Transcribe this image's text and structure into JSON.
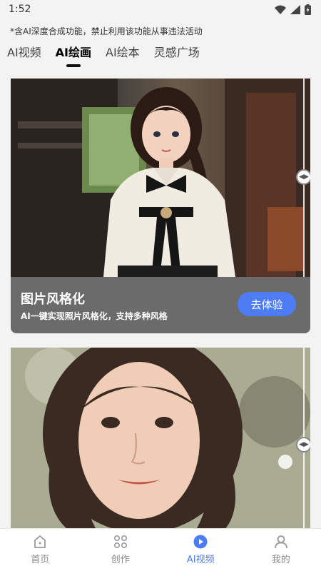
{
  "status": {
    "time": "1:52"
  },
  "notice": "*含AI深度合成功能，禁止利用该功能从事违法活动",
  "tabs": [
    {
      "label": "AI视频",
      "active": false
    },
    {
      "label": "AI绘画",
      "active": true
    },
    {
      "label": "AI绘本",
      "active": false
    },
    {
      "label": "灵感广场",
      "active": false
    }
  ],
  "cards": [
    {
      "title": "图片风格化",
      "subtitle": "AI一键实现照片风格化，支持多种风格",
      "button_label": "去体验"
    }
  ],
  "bottom_nav": [
    {
      "label": "首页",
      "icon": "home-icon",
      "active": false
    },
    {
      "label": "创作",
      "icon": "grid-icon",
      "active": false
    },
    {
      "label": "AI视频",
      "icon": "play-icon",
      "active": true
    },
    {
      "label": "我的",
      "icon": "user-icon",
      "active": false
    }
  ],
  "colors": {
    "accent": "#4d7cf5",
    "background": "#f3f3f3"
  }
}
